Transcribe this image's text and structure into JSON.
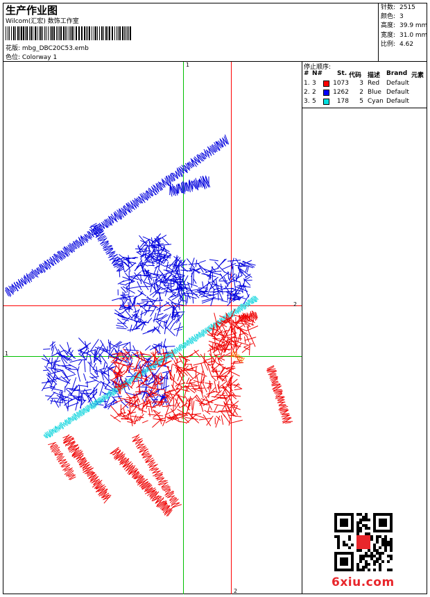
{
  "header": {
    "title": "生产作业图",
    "company": "Wilcom(汇宏) 数饰工作室",
    "design_file": "花版: mbg_DBC20C53.emb",
    "colorway": "色位: Colorway 1"
  },
  "stats": [
    {
      "label": "针数:",
      "value": "2515"
    },
    {
      "label": "颜色:",
      "value": "3"
    },
    {
      "label": "高度:",
      "value": "39.9 mm"
    },
    {
      "label": "宽度:",
      "value": "31.0 mm"
    },
    {
      "label": "比例:",
      "value": "4.62"
    }
  ],
  "stop_sequence": {
    "title": "停止顺序:",
    "headers": {
      "num": "#",
      "needle": "N#",
      "stitches": "St.",
      "code": "代码",
      "desc": "描述",
      "brand": "Brand",
      "element": "元素"
    },
    "rows": [
      {
        "num": "1.",
        "needle": "3",
        "color": "#ff0000",
        "stitches": "1073",
        "code": "3",
        "desc": "Red",
        "brand": "Default"
      },
      {
        "num": "2.",
        "needle": "2",
        "color": "#0000ff",
        "stitches": "1262",
        "code": "2",
        "desc": "Blue",
        "brand": "Default"
      },
      {
        "num": "3.",
        "needle": "5",
        "color": "#00e0e0",
        "stitches": "178",
        "code": "5",
        "desc": "Cyan",
        "brand": "Default"
      }
    ]
  },
  "canvas": {
    "axis_labels": {
      "top_green": "1",
      "left_green": "1",
      "right_red": "2",
      "bottom_red": "2"
    },
    "colors": {
      "guide_green": "#00c000",
      "guide_red": "#ff0000",
      "stitch_red": "#ee0000",
      "stitch_blue": "#0000dd",
      "stitch_cyan": "#22d8e0"
    }
  },
  "watermark": {
    "logo_text": "6xiu.com"
  }
}
